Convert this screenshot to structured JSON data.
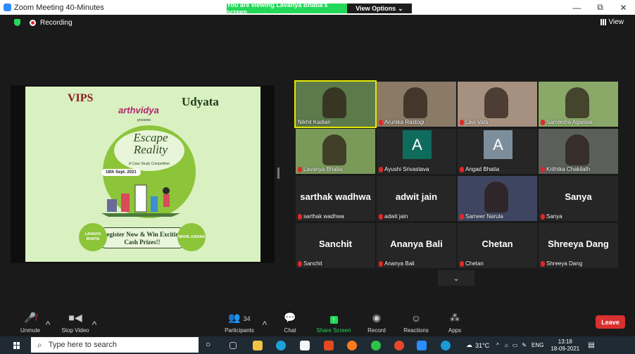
{
  "window": {
    "title": "Zoom Meeting 40-Minutes",
    "minimize": "—",
    "maximize": "⧉",
    "close": "✕"
  },
  "share_banner": "You are viewing Lavanya Bhatia's screen",
  "view_options": "View Options",
  "status": {
    "recording": "Recording",
    "view": "View"
  },
  "poster": {
    "logo_left": "VIPS",
    "brand": "arthvidya",
    "udyata": "Udyata",
    "presents": "presents",
    "title_line1": "Escape",
    "title_line2": "Reality",
    "subtitle": "A Case Study Competition",
    "date": "18th Sept. 2021",
    "cash": "Register Now & Win Exciting Cash Prizes!!",
    "left_contact": "LAVANYA BHATIA",
    "right_contact": "NIKHIL KADIAN"
  },
  "participants": [
    {
      "name": "Nikhil Kadian",
      "kind": "video",
      "bg": "#5d7a4a",
      "active": true
    },
    {
      "name": "Arunika Rastogi",
      "kind": "video",
      "bg": "#8a7a66"
    },
    {
      "name": "Lavi Vats",
      "kind": "video",
      "bg": "#a69080"
    },
    {
      "name": "Samiksha Agarwal",
      "kind": "video",
      "bg": "#8aa868"
    },
    {
      "name": "Lavanya Bhatia",
      "kind": "video",
      "bg": "#7a9a5a"
    },
    {
      "name": "Ayushi Srivastava",
      "kind": "avatar",
      "bg": "#0f6b5c",
      "letter": "A"
    },
    {
      "name": "Angad Bhatia",
      "kind": "avatar",
      "bg": "#7c8e9c",
      "letter": "A"
    },
    {
      "name": "Krithika Chakilath",
      "kind": "video",
      "bg": "#5a5f5a"
    },
    {
      "name": "sarthak wadhwa",
      "kind": "text"
    },
    {
      "name": "adwit jain",
      "kind": "text"
    },
    {
      "name": "Sameer Narula",
      "kind": "video",
      "bg": "#3e4560"
    },
    {
      "name": "Sanya",
      "kind": "text"
    },
    {
      "name": "Sanchit",
      "kind": "text"
    },
    {
      "name": "Ananya Bali",
      "kind": "text"
    },
    {
      "name": "Chetan",
      "kind": "text"
    },
    {
      "name": "Shreeya Dang",
      "kind": "text"
    }
  ],
  "toolbar": {
    "unmute": "Unmute",
    "stop_video": "Stop Video",
    "participants": "Participants",
    "participant_count": "34",
    "chat": "Chat",
    "share_screen": "Share Screen",
    "record": "Record",
    "reactions": "Reactions",
    "apps": "Apps",
    "leave": "Leave"
  },
  "taskbar": {
    "search_placeholder": "Type here to search",
    "temperature": "31°C",
    "language": "ENG",
    "time": "13:18",
    "date": "18-09-2021"
  },
  "colors": {
    "zoom_blue": "#2d8cff",
    "share_green": "#23d959",
    "leave_red": "#d93030",
    "active_speaker": "#e6e600"
  }
}
